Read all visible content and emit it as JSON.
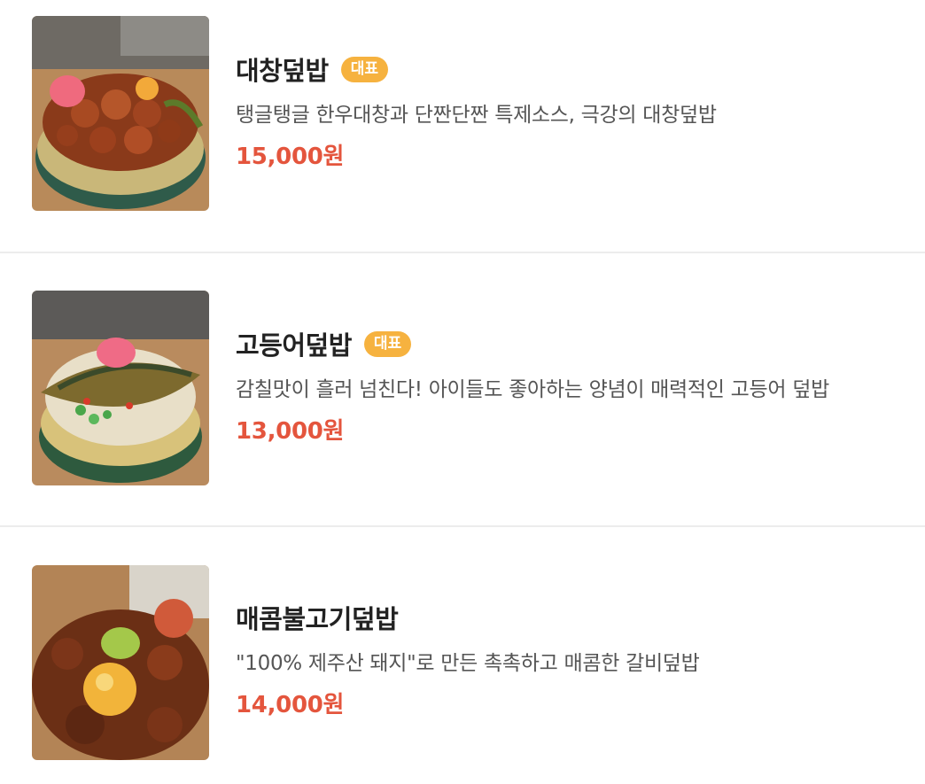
{
  "menu": {
    "items": [
      {
        "name": "대창덮밥",
        "badge": "대표",
        "description": "탱글탱글 한우대창과 단짠단짠 특제소스, 극강의 대창덮밥",
        "price": "15,000원",
        "image": "daechang-rice-bowl-photo"
      },
      {
        "name": "고등어덮밥",
        "badge": "대표",
        "description": "감칠맛이 흘러 넘친다! 아이들도 좋아하는 양념이 매력적인 고등어 덮밥",
        "price": "13,000원",
        "image": "mackerel-rice-bowl-photo"
      },
      {
        "name": "매콤불고기덮밥",
        "badge": "",
        "description": "\"100% 제주산 돼지\"로 만든 촉촉하고 매콤한 갈비덮밥",
        "price": "14,000원",
        "image": "spicy-bulgogi-rice-bowl-photo"
      }
    ]
  },
  "colors": {
    "badge_bg": "#f6b23f",
    "price": "#e4553d",
    "divider": "#ececec"
  }
}
